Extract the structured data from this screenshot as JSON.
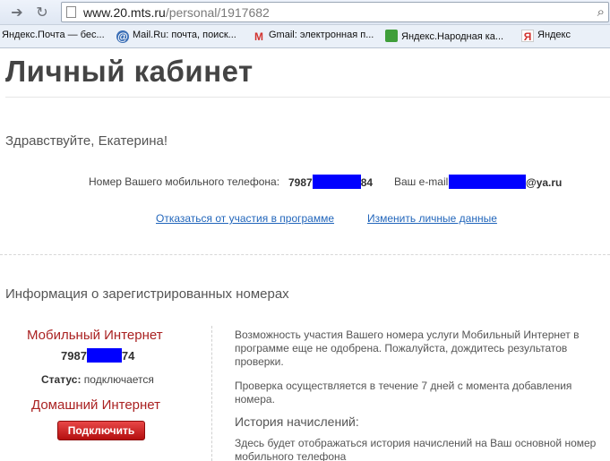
{
  "browser": {
    "back_icon": "arrow-right-icon",
    "reload_icon": "reload-icon",
    "url_host": "www.20.mts.ru",
    "url_path": "/personal/1917682",
    "search_icon": "magnifier-icon"
  },
  "bookmarks": [
    {
      "label": "Яндекс.Почта — бес...",
      "icon": ""
    },
    {
      "label": "Mail.Ru: почта, поиск...",
      "icon": "@"
    },
    {
      "label": "Gmail: электронная п...",
      "icon": "M"
    },
    {
      "label": "Яндекс.Народная ка...",
      "icon": "puzzle"
    },
    {
      "label": "Яндекс",
      "icon": "Я"
    }
  ],
  "page": {
    "title": "Личный кабинет",
    "greeting": "Здравствуйте, Екатерина!",
    "phone_label": "Номер Вашего мобильного телефона:",
    "phone_prefix": "7987",
    "phone_suffix": "84",
    "email_label": "Ваш e-mail:",
    "email_suffix": "@ya.ru",
    "link_optout": "Отказаться от участия в программе",
    "link_edit": "Изменить личные данные",
    "section_title": "Информация о зарегистрированных номерах"
  },
  "service": {
    "mobile_title": "Мобильный Интернет",
    "number_prefix": "7987",
    "number_suffix": "74",
    "status_label": "Статус:",
    "status_value": "подключается",
    "home_title": "Домашний Интернет",
    "connect_button": "Подключить"
  },
  "info": {
    "text1": "Возможность участия Вашего номера услуги Мобильный Интернет в программе еще не одобрена. Пожалуйста, дождитесь результатов проверки.",
    "text2": "Проверка осуществляется в течение 7 дней с момента добавления номера.",
    "history_title": "История начислений:",
    "text3": "Здесь будет отображаться история начислений на Ваш основной номер мобильного телефона"
  },
  "colors": {
    "redaction": "#0000ff",
    "link": "#2266bb",
    "service_title": "#aa2222",
    "button": "#cc1f1f"
  }
}
